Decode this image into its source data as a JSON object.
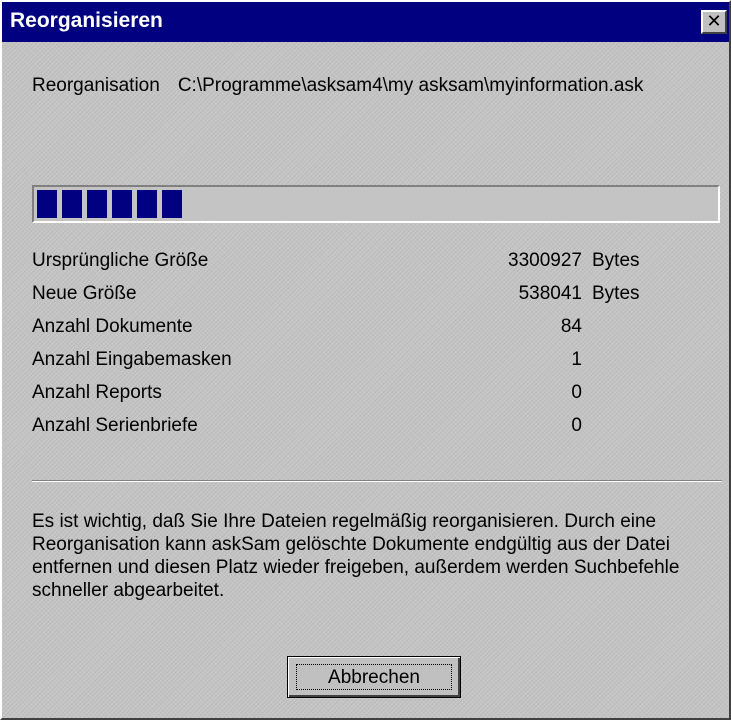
{
  "window": {
    "title": "Reorganisieren",
    "close_glyph": "✕"
  },
  "path": {
    "label": "Reorganisation",
    "value": "C:\\Programme\\asksam4\\my asksam\\myinformation.ask"
  },
  "progress": {
    "percent": 20,
    "blocks_filled": 6,
    "bar_color": "#000080"
  },
  "stats": [
    {
      "label": "Ursprüngliche Größe",
      "value": "3300927",
      "unit": "Bytes"
    },
    {
      "label": "Neue Größe",
      "value": "538041",
      "unit": "Bytes"
    },
    {
      "label": "Anzahl Dokumente",
      "value": "84",
      "unit": ""
    },
    {
      "label": "Anzahl Eingabemasken",
      "value": "1",
      "unit": ""
    },
    {
      "label": "Anzahl Reports",
      "value": "0",
      "unit": ""
    },
    {
      "label": "Anzahl Serienbriefe",
      "value": "0",
      "unit": ""
    }
  ],
  "info_text": "Es ist wichtig, daß Sie Ihre Dateien regelmäßig reorganisieren. Durch eine Reorganisation kann askSam gelöschte Dokumente endgültig aus der Datei entfernen und diesen Platz wieder freigeben, außerdem werden Suchbefehle schneller abgearbeitet.",
  "buttons": {
    "cancel_label": "Abbrechen"
  },
  "colors": {
    "titlebar": "#000080",
    "dialog_bg": "#c4c4c4"
  }
}
